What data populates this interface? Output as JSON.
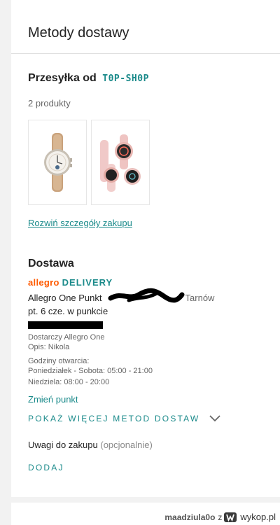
{
  "header": {
    "title": "Metody dostawy"
  },
  "shipment": {
    "label": "Przesyłka od",
    "seller": "T0P-SH0P",
    "product_count": "2 produkty",
    "details_link": "Rozwiń szczegóły zakupu"
  },
  "delivery": {
    "section_title": "Dostawa",
    "brand_part1": "allegro",
    "brand_part2": "DELIVERY",
    "pickup_name": "Allegro One Punkt",
    "pickup_city": "Tarnów",
    "pickup_date": "pt. 6 cze. w punkcie",
    "provider": "Dostarczy Allegro One",
    "description": "Opis: Nikola",
    "hours_label": "Godziny otwarcia:",
    "hours_weekdays": "Poniedziałek - Sobota: 05:00 - 21:00",
    "hours_sunday": "Niedziela: 08:00 - 20:00",
    "change_point": "Zmień punkt",
    "more_methods": "POKAŻ WIĘCEJ METOD DOSTAW"
  },
  "notes": {
    "label": "Uwagi do zakupu",
    "optional": "(opcjonalnie)",
    "add_button": "DODAJ"
  },
  "watermark": {
    "user": "maadziula0o",
    "word": "z",
    "site": "wykop.pl"
  },
  "colors": {
    "accent": "#1a8a8a",
    "allegro_orange": "#ff5a00"
  }
}
